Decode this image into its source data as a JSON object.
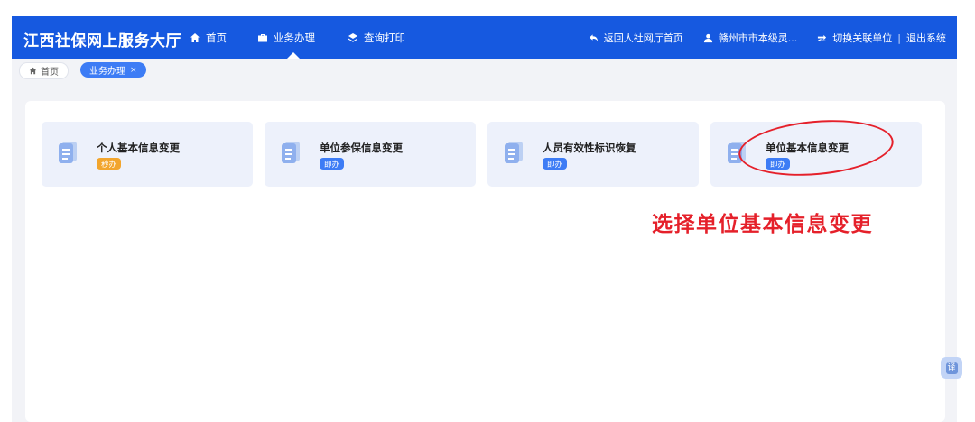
{
  "header": {
    "brand": "江西社保网上服务大厅",
    "nav": [
      {
        "label": "首页",
        "icon": "home-icon"
      },
      {
        "label": "业务办理",
        "icon": "briefcase-icon",
        "active": true
      },
      {
        "label": "查询打印",
        "icon": "layers-icon"
      }
    ],
    "right": {
      "back_label": "返回人社网厅首页",
      "user_label": "赣州市市本级灵...",
      "switch_label": "切换关联单位",
      "separator": "|",
      "logout_label": "退出系统"
    },
    "colors": {
      "bar": "#1659e0"
    }
  },
  "tabs": {
    "home": "首页",
    "current": "业务办理",
    "close": "×"
  },
  "cards": [
    {
      "title": "个人基本信息变更",
      "badge": "秒办",
      "badge_color": "#f2a52d"
    },
    {
      "title": "单位参保信息变更",
      "badge": "即办",
      "badge_color": "#3d7cf5"
    },
    {
      "title": "人员有效性标识恢复",
      "badge": "即办",
      "badge_color": "#3d7cf5"
    },
    {
      "title": "单位基本信息变更",
      "badge": "即办",
      "badge_color": "#3d7cf5"
    }
  ],
  "annotation": {
    "text": "选择单位基本信息变更",
    "color": "#e5202a"
  },
  "float_button": {
    "label": "译"
  }
}
